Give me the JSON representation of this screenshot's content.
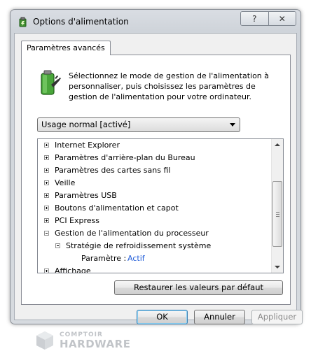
{
  "window": {
    "title": "Options d'alimentation",
    "help_button": "?",
    "close_button": "✕"
  },
  "tab": {
    "label": "Paramètres avancés"
  },
  "intro": {
    "text": "Sélectionnez le mode de gestion de l'alimentation à personnaliser, puis choisissez les paramètres de gestion de l'alimentation pour votre ordinateur."
  },
  "plan_select": {
    "selected": "Usage normal [activé]"
  },
  "tree": {
    "items": [
      {
        "label": "Internet Explorer",
        "expander": "plus"
      },
      {
        "label": "Paramètres d'arrière-plan du Bureau",
        "expander": "plus"
      },
      {
        "label": "Paramètres des cartes sans fil",
        "expander": "plus"
      },
      {
        "label": "Veille",
        "expander": "plus"
      },
      {
        "label": "Paramètres USB",
        "expander": "plus"
      },
      {
        "label": "Boutons d'alimentation et capot",
        "expander": "plus"
      },
      {
        "label": "PCI Express",
        "expander": "plus"
      },
      {
        "label": "Gestion de l'alimentation du processeur",
        "expander": "minus"
      },
      {
        "label": "Stratégie de refroidissement système",
        "expander": "minus"
      },
      {
        "label": "Paramètre :",
        "value": "Actif"
      },
      {
        "label": "Affichage",
        "expander": "plus"
      }
    ]
  },
  "buttons": {
    "restore": "Restaurer les valeurs par défaut",
    "ok": "OK",
    "cancel": "Annuler",
    "apply": "Appliquer"
  },
  "watermark": {
    "top": "COMPTOIR",
    "main": "HARDWARE"
  },
  "colors": {
    "value_link": "#1e5ad8",
    "accent_border": "#3c7fb1"
  }
}
